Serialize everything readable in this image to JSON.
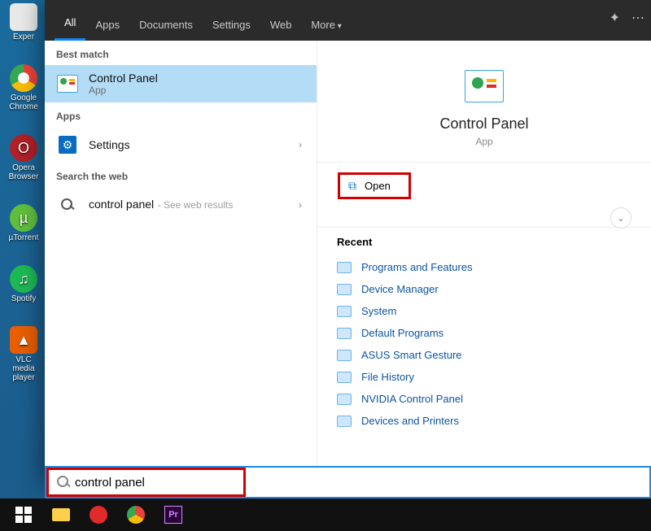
{
  "desktop_icons": [
    {
      "name": "exper",
      "label": "Exper"
    },
    {
      "name": "chrome",
      "label": "Google Chrome"
    },
    {
      "name": "opera",
      "label": "Opera Browser"
    },
    {
      "name": "utorrent",
      "label": "µTorrent"
    },
    {
      "name": "spotify",
      "label": "Spotify"
    },
    {
      "name": "vlc",
      "label": "VLC media player"
    }
  ],
  "tabs": {
    "all": "All",
    "apps": "Apps",
    "documents": "Documents",
    "settings": "Settings",
    "web": "Web",
    "more": "More"
  },
  "left": {
    "best_match": "Best match",
    "cp_title": "Control Panel",
    "cp_sub": "App",
    "apps_header": "Apps",
    "settings_item": "Settings",
    "web_header": "Search the web",
    "web_item": "control panel",
    "web_hint": "- See web results"
  },
  "right": {
    "hero_title": "Control Panel",
    "hero_sub": "App",
    "open": "Open",
    "recent_header": "Recent",
    "recent_items": [
      "Programs and Features",
      "Device Manager",
      "System",
      "Default Programs",
      "ASUS Smart Gesture",
      "File History",
      "NVIDIA Control Panel",
      "Devices and Printers"
    ]
  },
  "search": {
    "value": "control panel"
  }
}
